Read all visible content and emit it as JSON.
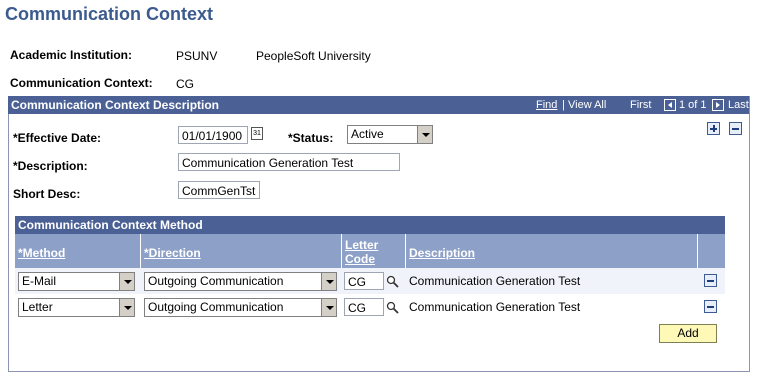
{
  "page": {
    "title": "Communication Context"
  },
  "header": {
    "institution_label": "Academic Institution:",
    "institution_code": "PSUNV",
    "institution_name": "PeopleSoft University",
    "context_label": "Communication Context:",
    "context_value": "CG"
  },
  "section": {
    "title": "Communication Context Description",
    "nav": {
      "find": "Find",
      "view_all": "View All",
      "first": "First",
      "range": "1 of 1",
      "last": "Last"
    },
    "effective_date_label": "*Effective Date:",
    "effective_date_value": "01/01/1900",
    "status_label": "*Status:",
    "status_value": "Active",
    "description_label": "*Description:",
    "description_value": "Communication Generation Test",
    "short_desc_label": "Short Desc:",
    "short_desc_value": "CommGenTst"
  },
  "method_grid": {
    "title": "Communication Context Method",
    "columns": {
      "method": "*Method",
      "direction": "*Direction",
      "letter_code_1": "Letter",
      "letter_code_2": "Code",
      "description": "Description"
    },
    "rows": [
      {
        "method": "E-Mail",
        "direction": "Outgoing Communication",
        "letter_code": "CG",
        "description": "Communication Generation Test"
      },
      {
        "method": "Letter",
        "direction": "Outgoing Communication",
        "letter_code": "CG",
        "description": "Communication Generation Test"
      }
    ],
    "add_label": "Add"
  },
  "icons": {
    "calendar": "calendar-icon",
    "lookup": "magnifier-icon",
    "add_row": "plus-icon",
    "delete_row": "minus-icon"
  }
}
